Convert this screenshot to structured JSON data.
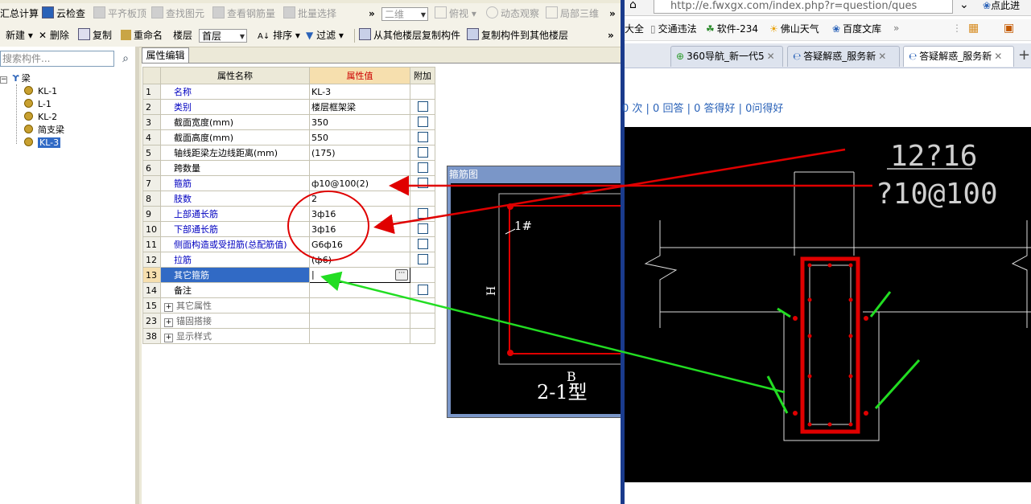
{
  "app": {
    "toolbar1": [
      {
        "label": "汇总计算",
        "icon": "calculator-icon",
        "disabled": false
      },
      {
        "label": "云检查",
        "icon": "cloud-check-icon",
        "disabled": false
      },
      {
        "label": "平齐板顶",
        "icon": "align-icon",
        "disabled": true
      },
      {
        "label": "查找图元",
        "icon": "binoculars-icon",
        "disabled": true
      },
      {
        "label": "查看钢筋量",
        "icon": "rebar-view-icon",
        "disabled": true
      },
      {
        "label": "批量选择",
        "icon": "batch-select-icon",
        "disabled": true
      }
    ],
    "toolbar1_right": {
      "view2d": "二维",
      "view_mode": "俯视",
      "dynamic": "动态观察",
      "local3d": "局部三维"
    },
    "toolbar2": {
      "new": "新建",
      "delete": "删除",
      "copy": "复制",
      "rename": "重命名",
      "floor_label": "楼层",
      "floor_value": "首层",
      "sort": "排序",
      "filter": "过滤",
      "copy_from": "从其他楼层复制构件",
      "copy_to": "复制构件到其他楼层"
    },
    "search_placeholder": "搜索构件...",
    "tree": {
      "root": "梁",
      "items": [
        "KL-1",
        "L-1",
        "KL-2",
        "简支梁",
        "KL-3"
      ],
      "selected": "KL-3"
    },
    "tab_label": "属性编辑",
    "grid": {
      "headers": {
        "name": "属性名称",
        "value": "属性值",
        "extra": "附加"
      },
      "rows": [
        {
          "n": "1",
          "name": "名称",
          "value": "KL-3",
          "blue": true,
          "check": false,
          "plus": false
        },
        {
          "n": "2",
          "name": "类别",
          "value": "楼层框架梁",
          "blue": true,
          "check": true,
          "plus": false
        },
        {
          "n": "3",
          "name": "截面宽度(mm)",
          "value": "350",
          "blue": false,
          "check": true,
          "plus": false
        },
        {
          "n": "4",
          "name": "截面高度(mm)",
          "value": "550",
          "blue": false,
          "check": true,
          "plus": false
        },
        {
          "n": "5",
          "name": "轴线距梁左边线距离(mm)",
          "value": "(175)",
          "blue": false,
          "check": true,
          "plus": false
        },
        {
          "n": "6",
          "name": "跨数量",
          "value": "",
          "blue": false,
          "check": true,
          "plus": false
        },
        {
          "n": "7",
          "name": "箍筋",
          "value": "ф10@100(2)",
          "blue": true,
          "check": true,
          "plus": false
        },
        {
          "n": "8",
          "name": "肢数",
          "value": "2",
          "blue": true,
          "check": false,
          "plus": false
        },
        {
          "n": "9",
          "name": "上部通长筋",
          "value": "3ф16",
          "blue": true,
          "check": true,
          "plus": false
        },
        {
          "n": "10",
          "name": "下部通长筋",
          "value": "3ф16",
          "blue": true,
          "check": true,
          "plus": false
        },
        {
          "n": "11",
          "name": "侧面构造或受扭筋(总配筋值)",
          "value": "G6ф16",
          "blue": true,
          "check": true,
          "plus": false
        },
        {
          "n": "12",
          "name": "拉筋",
          "value": "(ф6)",
          "blue": true,
          "check": true,
          "plus": false
        },
        {
          "n": "13",
          "name": "其它箍筋",
          "value": "",
          "blue": false,
          "check": false,
          "plus": false,
          "selected": true
        },
        {
          "n": "14",
          "name": "备注",
          "value": "",
          "blue": false,
          "check": true,
          "plus": false
        },
        {
          "n": "15",
          "name": "其它属性",
          "value": "",
          "blue": false,
          "check": false,
          "plus": true
        },
        {
          "n": "23",
          "name": "锚固搭接",
          "value": "",
          "blue": false,
          "check": false,
          "plus": true
        },
        {
          "n": "38",
          "name": "显示样式",
          "value": "",
          "blue": false,
          "check": false,
          "plus": true
        }
      ]
    },
    "popup": {
      "title": "箍筋图",
      "tag": "1#",
      "h": "H",
      "b": "B",
      "type": "2-1型"
    }
  },
  "browser": {
    "url": "http://e.fwxgx.com/index.php?r=question/ques",
    "right_label": "点此进",
    "favorites": [
      "大全",
      "交通违法",
      "软件-234",
      "佛山天气",
      "百度文库"
    ],
    "tabs": [
      {
        "label": "360导航_新一代5",
        "active": false
      },
      {
        "label": "答疑解惑_服务新",
        "active": false
      },
      {
        "label": "答疑解惑_服务新",
        "active": true
      }
    ],
    "stats": "0 次 | 0 回答 | 0 答得好 | 0问得好",
    "cad": {
      "top_bars": "12?16",
      "stirrup": "?10@100"
    }
  },
  "colors": {
    "annotation_red": "#e00000",
    "annotation_green": "#22dd22",
    "cad_bg": "#000000",
    "selection_blue": "#316ac5"
  }
}
